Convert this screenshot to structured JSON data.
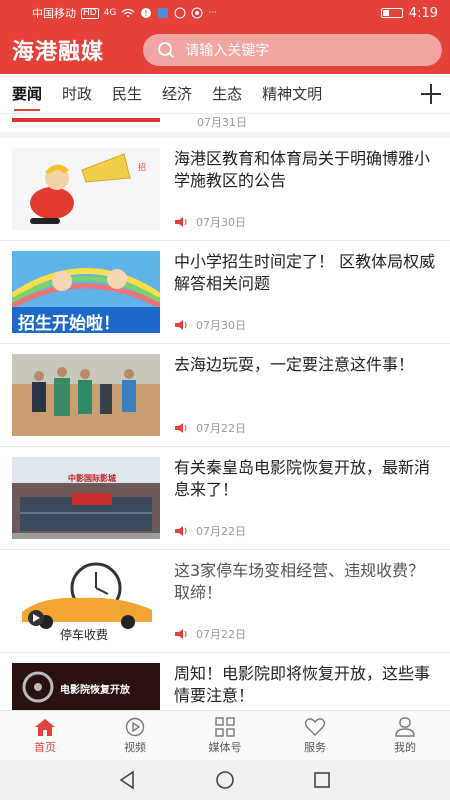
{
  "status_bar": {
    "carrier": "中国移动",
    "network": "HD",
    "signal": "4G",
    "more": "···",
    "time": "4:19"
  },
  "header": {
    "app_title": "海港融媒",
    "search_placeholder": "请输入关键字"
  },
  "tabs": [
    {
      "label": "要闻",
      "active": true
    },
    {
      "label": "时政",
      "active": false
    },
    {
      "label": "民生",
      "active": false
    },
    {
      "label": "经济",
      "active": false
    },
    {
      "label": "生态",
      "active": false
    },
    {
      "label": "精神文明",
      "active": false
    }
  ],
  "partial_item": {
    "date": "07月31日"
  },
  "news": [
    {
      "title": "海港区教育和体育局关于明确博雅小学施教区的公告",
      "date": "07月30日",
      "thumb": "megaphone-cartoon"
    },
    {
      "title": "中小学招生时间定了！ 区教体局权威解答相关问题",
      "date": "07月30日",
      "thumb": "enrollment-banner",
      "thumb_text": "招生开始啦！"
    },
    {
      "title": "去海边玩耍，一定要注意这件事！",
      "date": "07月22日",
      "thumb": "beach-rescue-photo"
    },
    {
      "title": "有关秦皇岛电影院恢复开放，最新消息来了！",
      "date": "07月22日",
      "thumb": "cinema-building-photo",
      "thumb_text": "中影国际影城"
    },
    {
      "title": "这3家停车场变相经营、违规收费？取缔！",
      "date": "07月22日",
      "thumb": "parking-clock-car",
      "thumb_text": "停车收费",
      "muted": true
    },
    {
      "title": "周知！电影院即将恢复开放，这些事情要注意！",
      "date": "",
      "thumb": "cinema-reopen-banner",
      "thumb_text": "电影院恢复开放"
    }
  ],
  "bottom_nav": [
    {
      "label": "首页",
      "icon": "home-icon",
      "active": true
    },
    {
      "label": "视频",
      "icon": "play-icon",
      "active": false
    },
    {
      "label": "媒体号",
      "icon": "grid-icon",
      "active": false
    },
    {
      "label": "服务",
      "icon": "heart-icon",
      "active": false
    },
    {
      "label": "我的",
      "icon": "user-icon",
      "active": false
    }
  ],
  "colors": {
    "brand": "#e5413b",
    "search_bg": "#f0a5a2"
  }
}
